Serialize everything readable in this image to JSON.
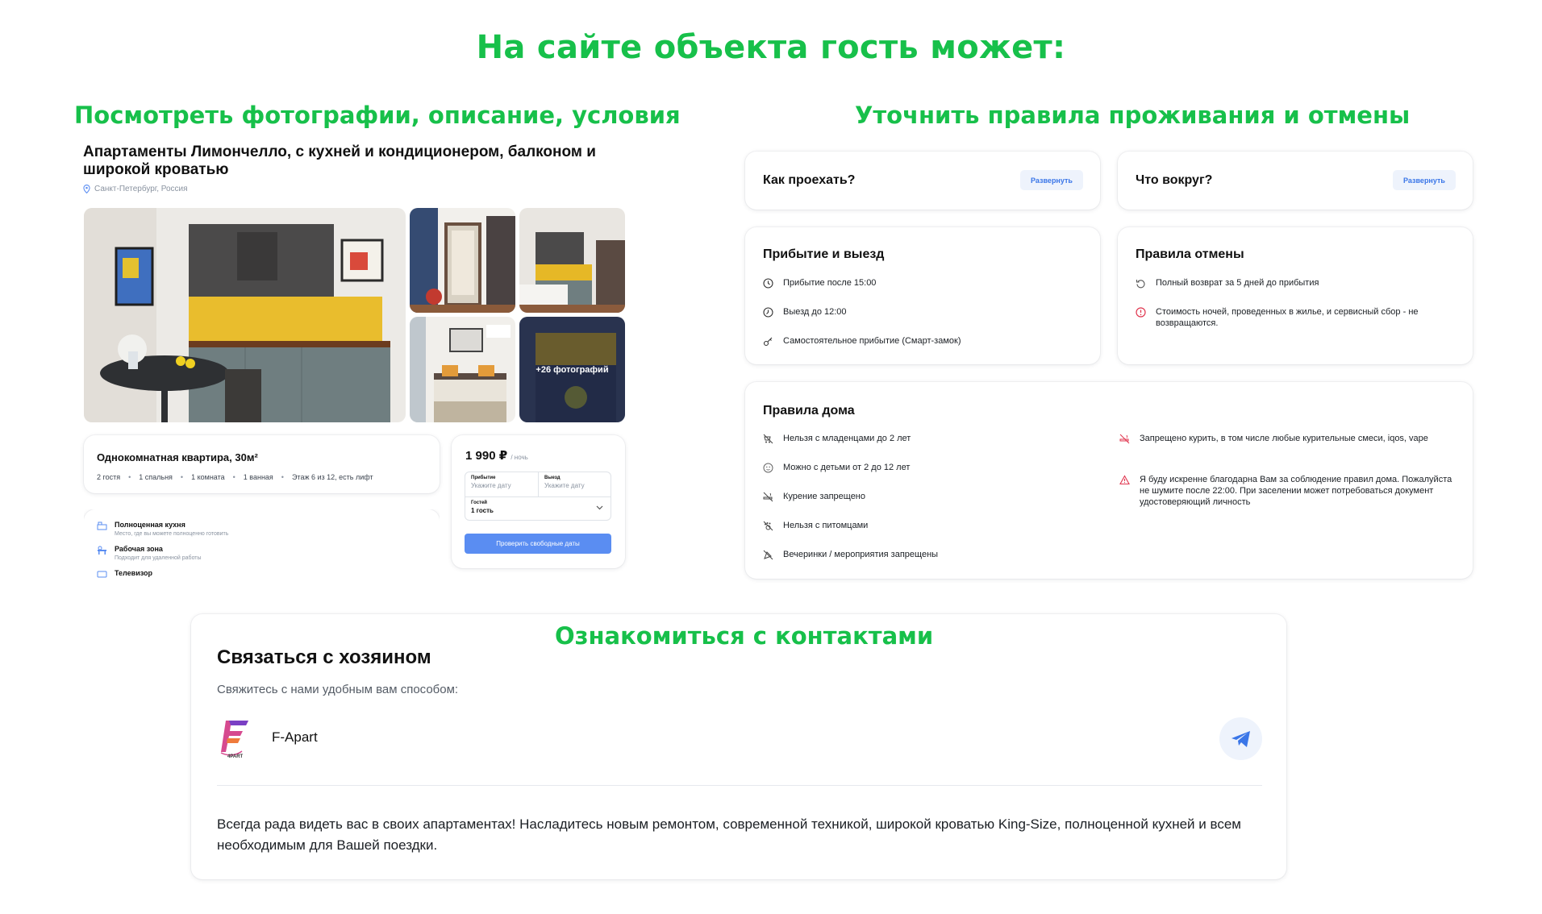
{
  "main_title": "На сайте объекта гость может:",
  "sections": {
    "photos": "Посмотреть фотографии, описание, условия",
    "rules": "Уточнить правила проживания  и отмены",
    "contacts": "Ознакомиться с контактами"
  },
  "listing": {
    "title": "Апартаменты Лимончелло, с кухней и кондиционером, балконом и широкой кроватью",
    "location": "Санкт-Петербург, Россия",
    "more_photos": "+26 фотографий",
    "apt_type": "Однокомнатная квартира, 30м²",
    "specs": [
      "2 гостя",
      "1 спальня",
      "1 комната",
      "1 ванная",
      "Этаж 6 из 12, есть лифт"
    ],
    "amenities": [
      {
        "name": "Полноценная кухня",
        "desc": "Место, где вы можете полноценно готовить",
        "icon": "kitchen-icon"
      },
      {
        "name": "Рабочая зона",
        "desc": "Подходит для удаленной работы",
        "icon": "workspace-icon"
      },
      {
        "name": "Телевизор",
        "desc": "",
        "icon": "tv-icon"
      }
    ],
    "price": "1 990 ₽",
    "price_unit": "/ ночь",
    "checkin_label": "Прибытие",
    "checkin_value": "Укажите дату",
    "checkout_label": "Выезд",
    "checkout_value": "Укажите дату",
    "guests_label": "Гостей",
    "guests_value": "1 гость",
    "check_button": "Проверить свободные даты"
  },
  "rules": {
    "how_to_get": "Как проехать?",
    "whats_around": "Что вокруг?",
    "expand_label": "Развернуть",
    "arrival_title": "Прибытие и выезд",
    "arrival_items": [
      "Прибытие после 15:00",
      "Выезд до 12:00",
      "Самостоятельное прибытие (Смарт-замок)"
    ],
    "cancel_title": "Правила отмены",
    "cancel_items": [
      "Полный возврат за 5 дней до прибытия",
      "Стоимость ночей, проведенных в жилье, и сервисный сбор - не возвращаются."
    ],
    "house_title": "Правила дома",
    "house_items_left": [
      "Нельзя с младенцами до 2 лет",
      "Можно с детьми от 2 до 12 лет",
      "Курение запрещено",
      "Нельзя с питомцами",
      "Вечеринки / мероприятия запрещены"
    ],
    "house_items_right": [
      "Запрещено курить, в том числе любые курительные смеси, iqos, vape",
      "Я буду искренне благодарна Вам за соблюдение правил дома. Пожалуйста не шумите после 22:00. При заселении может потребоваться документ удостоверяющий личность"
    ]
  },
  "contacts": {
    "title": "Связаться с хозяином",
    "subtitle": "Свяжитесь с нами удобным вам способом:",
    "host_name": "F-Apart",
    "logo_text": "4PART",
    "description": "Всегда рада видеть вас в своих апартаментах! Насладитесь новым ремонтом, современной техникой, широкой кроватью King-Size, полноценной кухней и всем необходимым для Вашей поездки."
  },
  "colors": {
    "accent_green": "#17c04a",
    "accent_blue": "#5a8df2",
    "danger_red": "#e0364f"
  }
}
